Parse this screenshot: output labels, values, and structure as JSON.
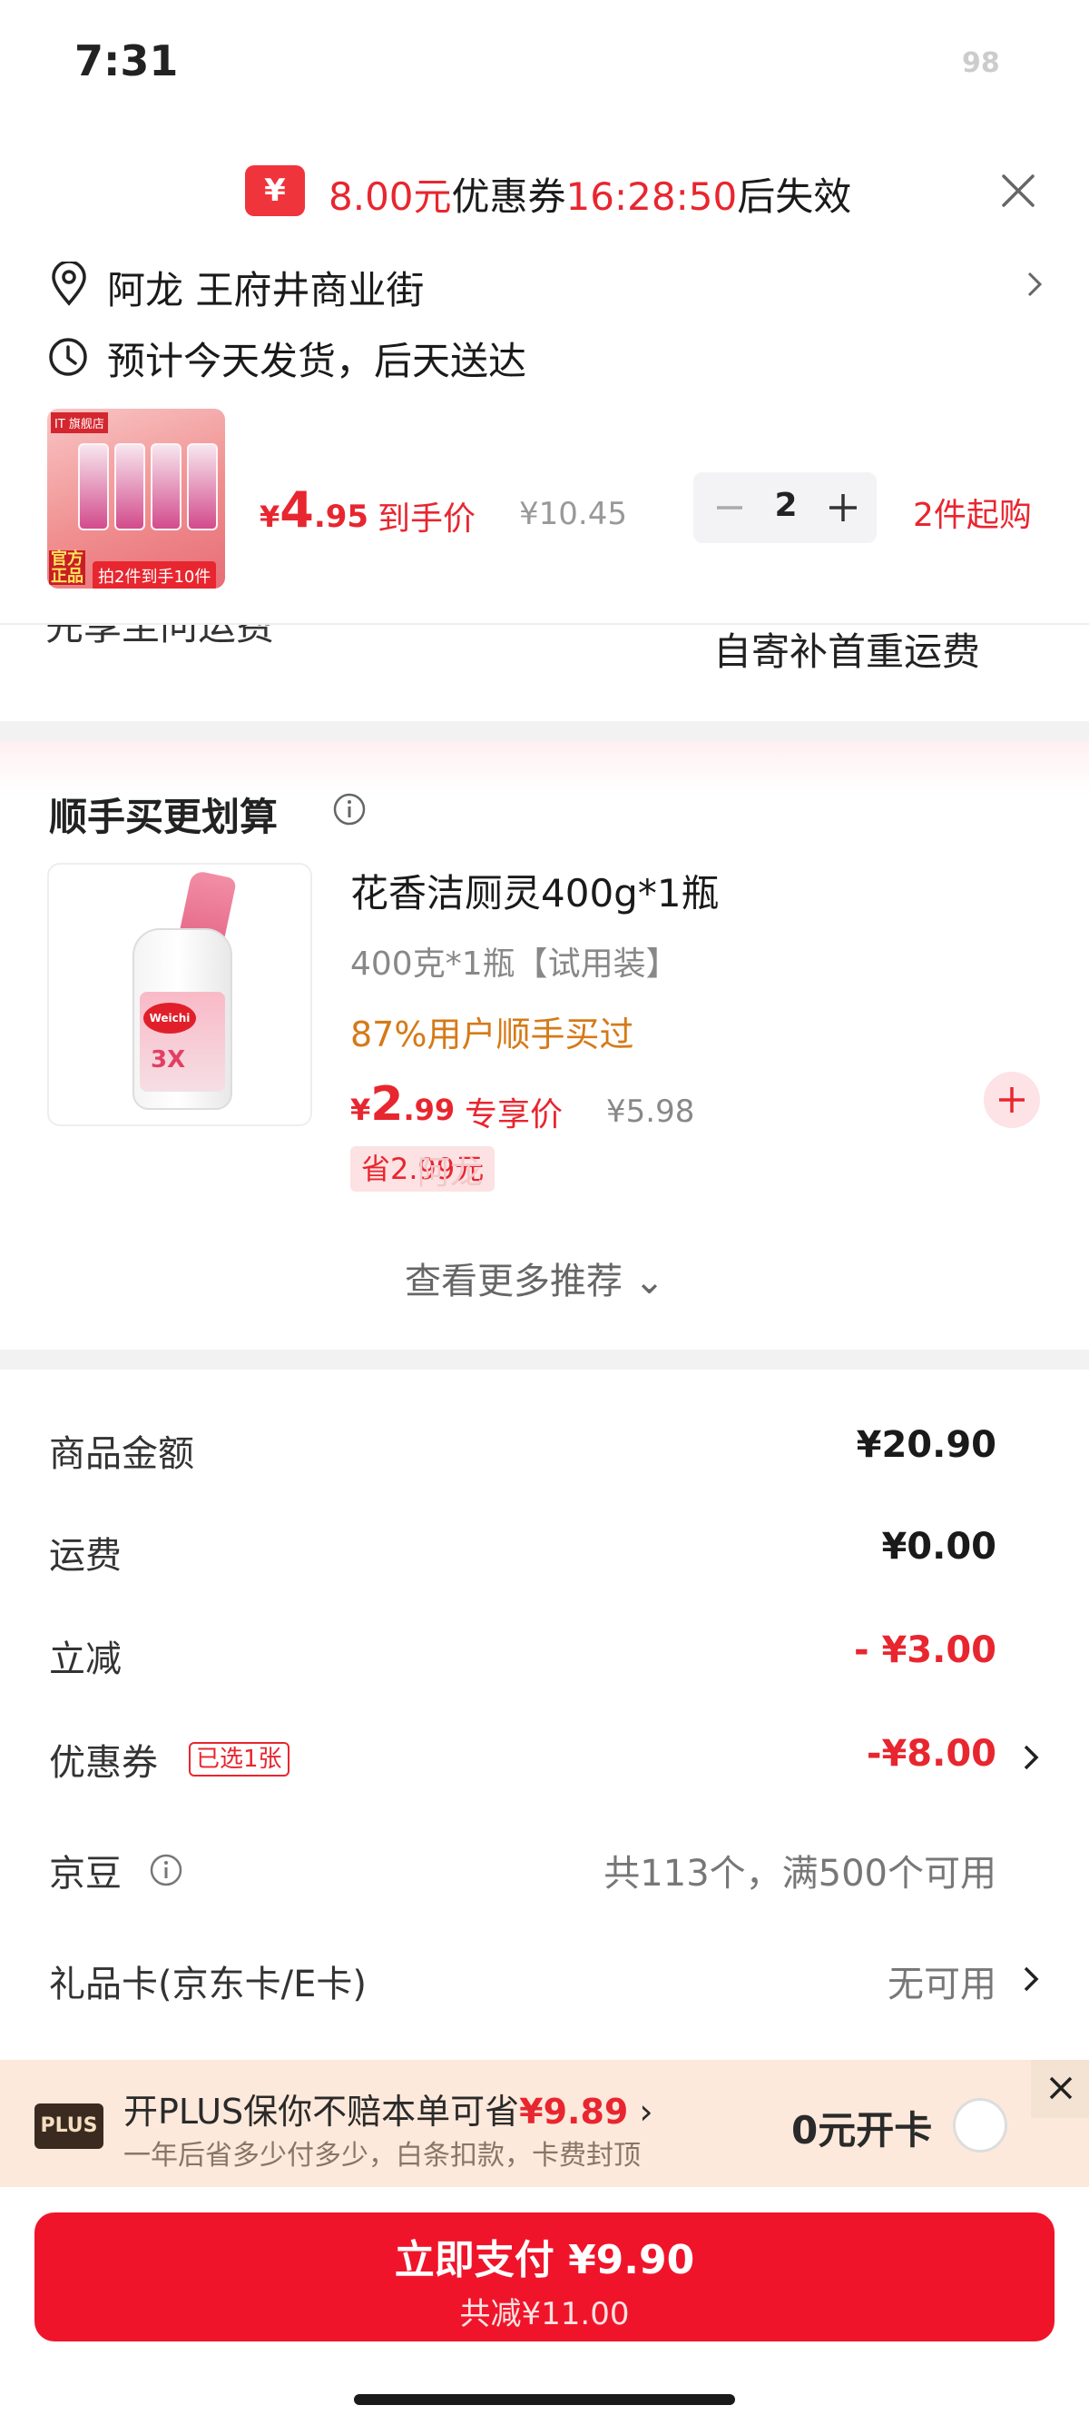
{
  "status": {
    "time": "7:31",
    "battery": "98"
  },
  "coupon_banner": {
    "icon_glyph": "¥",
    "amount": "8.00元",
    "mid": "优惠券",
    "countdown": "16:28:50",
    "suffix": "后失效"
  },
  "address": {
    "name": "阿龙",
    "street": "王府井商业街"
  },
  "shipping": {
    "text": "预计今天发货，后天送达"
  },
  "product": {
    "thumb_top": "IT 旗舰店",
    "thumb_gov": "官方正品",
    "thumb_badge": "拍2件到手10件",
    "price_symbol": "¥",
    "price_int": "4",
    "price_dec": ".95",
    "price_label": "到手价",
    "original_price": "¥10.45",
    "quantity": "2",
    "min_order": "2件起购"
  },
  "cut_section": {
    "text": "先享至问运费",
    "shipping_note": "自寄补首重运费"
  },
  "recommend": {
    "title": "顺手买更划算",
    "item": {
      "brand": "Weichi",
      "tag": "3X",
      "name": "花香洁厕灵400g*1瓶",
      "spec": "400克*1瓶【试用装】",
      "social": "87%用户顺手买过",
      "price_symbol": "¥",
      "price_int": "2",
      "price_dec": ".99",
      "price_label": "专享价",
      "original_price": "¥5.98",
      "save": "省2.99元",
      "watermark": "阿龙"
    },
    "see_more": "查看更多推荐"
  },
  "summary": {
    "goods_label": "商品金额",
    "goods_value": "¥20.90",
    "freight_label": "运费",
    "freight_value": "¥0.00",
    "discount_label": "立减",
    "discount_value": "- ¥3.00",
    "coupon_label": "优惠券",
    "coupon_badge": "已选1张",
    "coupon_value": "-¥8.00",
    "jd_label": "京豆",
    "jd_value": "共113个，满500个可用",
    "gift_label": "礼品卡(京东卡/E卡)",
    "gift_value": "无可用"
  },
  "plus": {
    "logo": "PLUS",
    "main_prefix": "开PLUS保你不赔本单可省",
    "main_amount": "¥9.89",
    "sub": "一年后省多少付多少，白条扣款，卡费封顶",
    "cta": "0元开卡"
  },
  "pay": {
    "main": "立即支付 ¥9.90",
    "sub": "共减¥11.00"
  },
  "colors": {
    "accent": "#e8262f",
    "pay_button": "#f0142a",
    "plus_bg": "#fde9db"
  }
}
